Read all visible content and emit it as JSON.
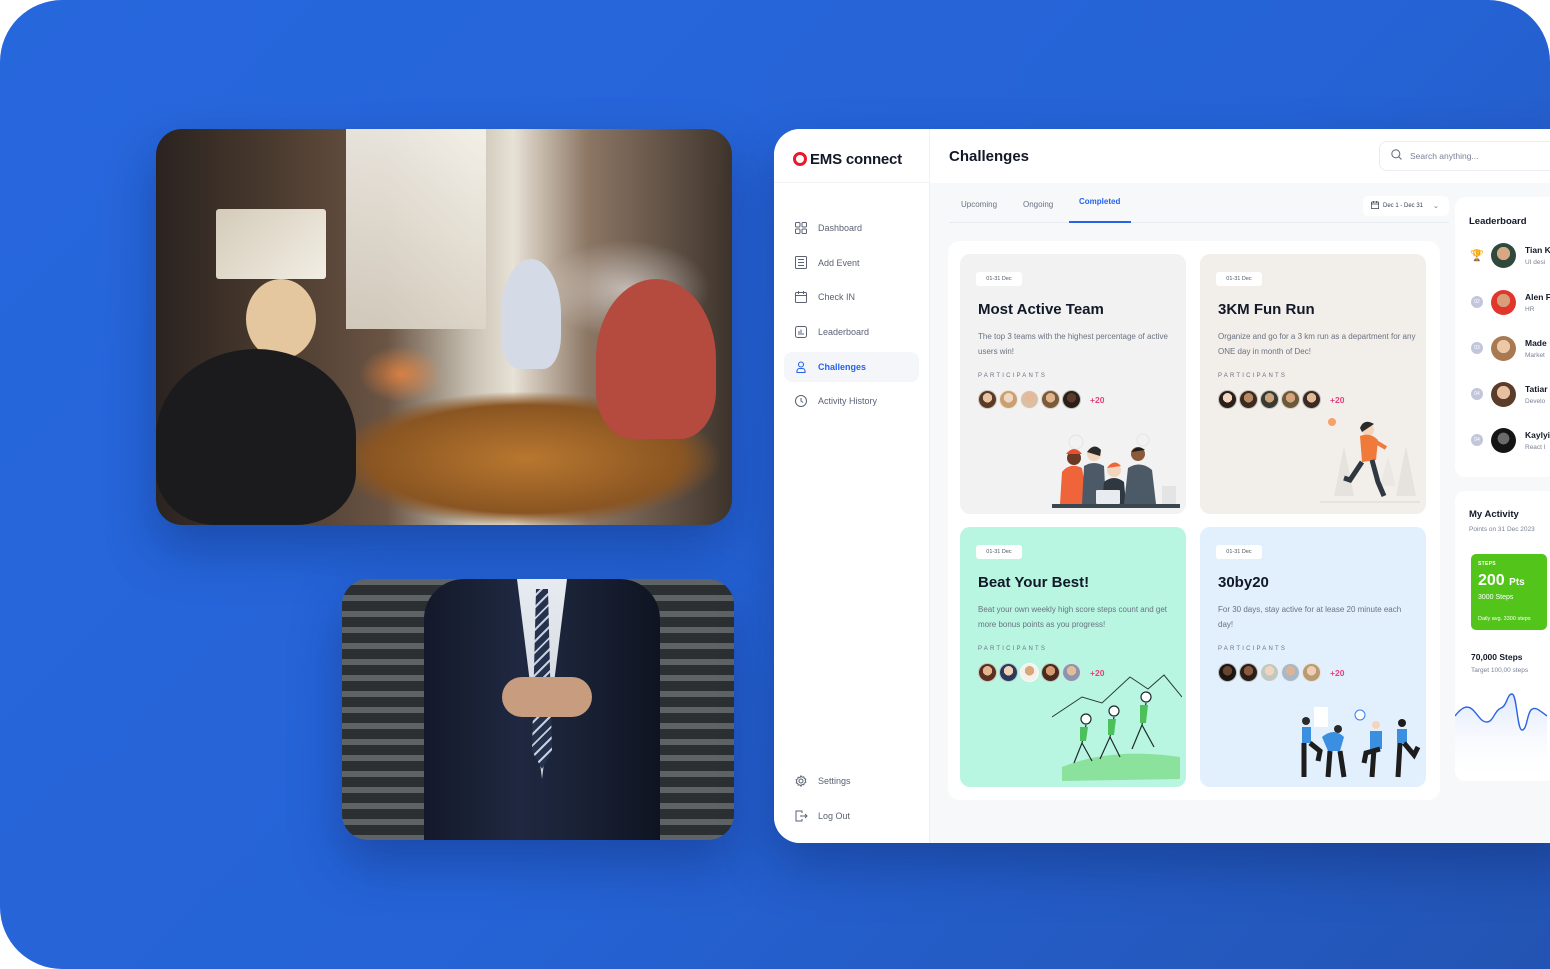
{
  "app": {
    "brand": "EMS connect",
    "brand_color": "#e8192c",
    "accent_color": "#2563eb"
  },
  "sidebar": {
    "items": [
      {
        "label": "Dashboard",
        "icon": "grid-icon",
        "active": false
      },
      {
        "label": "Add Event",
        "icon": "list-icon",
        "active": false
      },
      {
        "label": "Check IN",
        "icon": "calendar-icon",
        "active": false
      },
      {
        "label": "Leaderboard",
        "icon": "chart-icon",
        "active": false
      },
      {
        "label": "Challenges",
        "icon": "user-icon",
        "active": true
      },
      {
        "label": "Activity History",
        "icon": "clock-icon",
        "active": false
      }
    ],
    "bottom_items": [
      {
        "label": "Settings",
        "icon": "gear-icon"
      },
      {
        "label": "Log Out",
        "icon": "logout-icon"
      }
    ]
  },
  "header": {
    "title": "Challenges",
    "search_placeholder": "Search anything..."
  },
  "tabs": [
    {
      "label": "Upcoming",
      "active": false
    },
    {
      "label": "Ongoing",
      "active": false
    },
    {
      "label": "Completed",
      "active": true
    }
  ],
  "date_filter": {
    "label": "Dec 1 - Dec 31"
  },
  "challenges": [
    {
      "date": "01-31 Dec",
      "title": "Most Active Team",
      "description": "The top 3 teams with the highest percentage of active users win!",
      "participants_label": "PARTICIPANTS",
      "more": "+20",
      "bg": "#f2f2f2",
      "illustration": "team-laptop-illustration"
    },
    {
      "date": "01-31 Dec",
      "title": "3KM Fun Run",
      "description": "Organize and go for a 3 km run as a department for any ONE day in month of Dec!",
      "participants_label": "PARTICIPANTS",
      "more": "+20",
      "bg": "#f2eeea",
      "illustration": "runner-illustration"
    },
    {
      "date": "01-31 Dec",
      "title": "Beat Your Best!",
      "description": "Beat your own weekly high score steps count and get more bonus points as you progress!",
      "participants_label": "PARTICIPANTS",
      "more": "+20",
      "bg": "#b9f6e2",
      "illustration": "hikers-illustration"
    },
    {
      "date": "01-31 Dec",
      "title": "30by20",
      "description": "For 30 days, stay active for at lease 20 minute each day!",
      "participants_label": "PARTICIPANTS",
      "more": "+20",
      "bg": "#e2f0fd",
      "illustration": "stretching-illustration"
    }
  ],
  "leaderboard": {
    "title": "Leaderboard",
    "entries": [
      {
        "rank": "01",
        "name": "Tian K",
        "role": "UI desi",
        "trophy": true
      },
      {
        "rank": "02",
        "name": "Alen F",
        "role": "HR",
        "trophy": false
      },
      {
        "rank": "03",
        "name": "Made",
        "role": "Market",
        "trophy": false
      },
      {
        "rank": "04",
        "name": "Tatiar",
        "role": "Develo",
        "trophy": false
      },
      {
        "rank": "04",
        "name": "Kaylyi",
        "role": "React I",
        "trophy": false
      }
    ]
  },
  "activity": {
    "title": "My Activity",
    "subtitle": "Points on 31 Dec 2023",
    "steps_card": {
      "label": "STEPS",
      "points": "200",
      "points_unit": "Pts",
      "steps": "3000 Steps",
      "daily_avg": "Daily avg. 3300 steps",
      "color": "#52c41a"
    },
    "total": "70,000 Steps",
    "target": "Target 100,00 steps"
  }
}
